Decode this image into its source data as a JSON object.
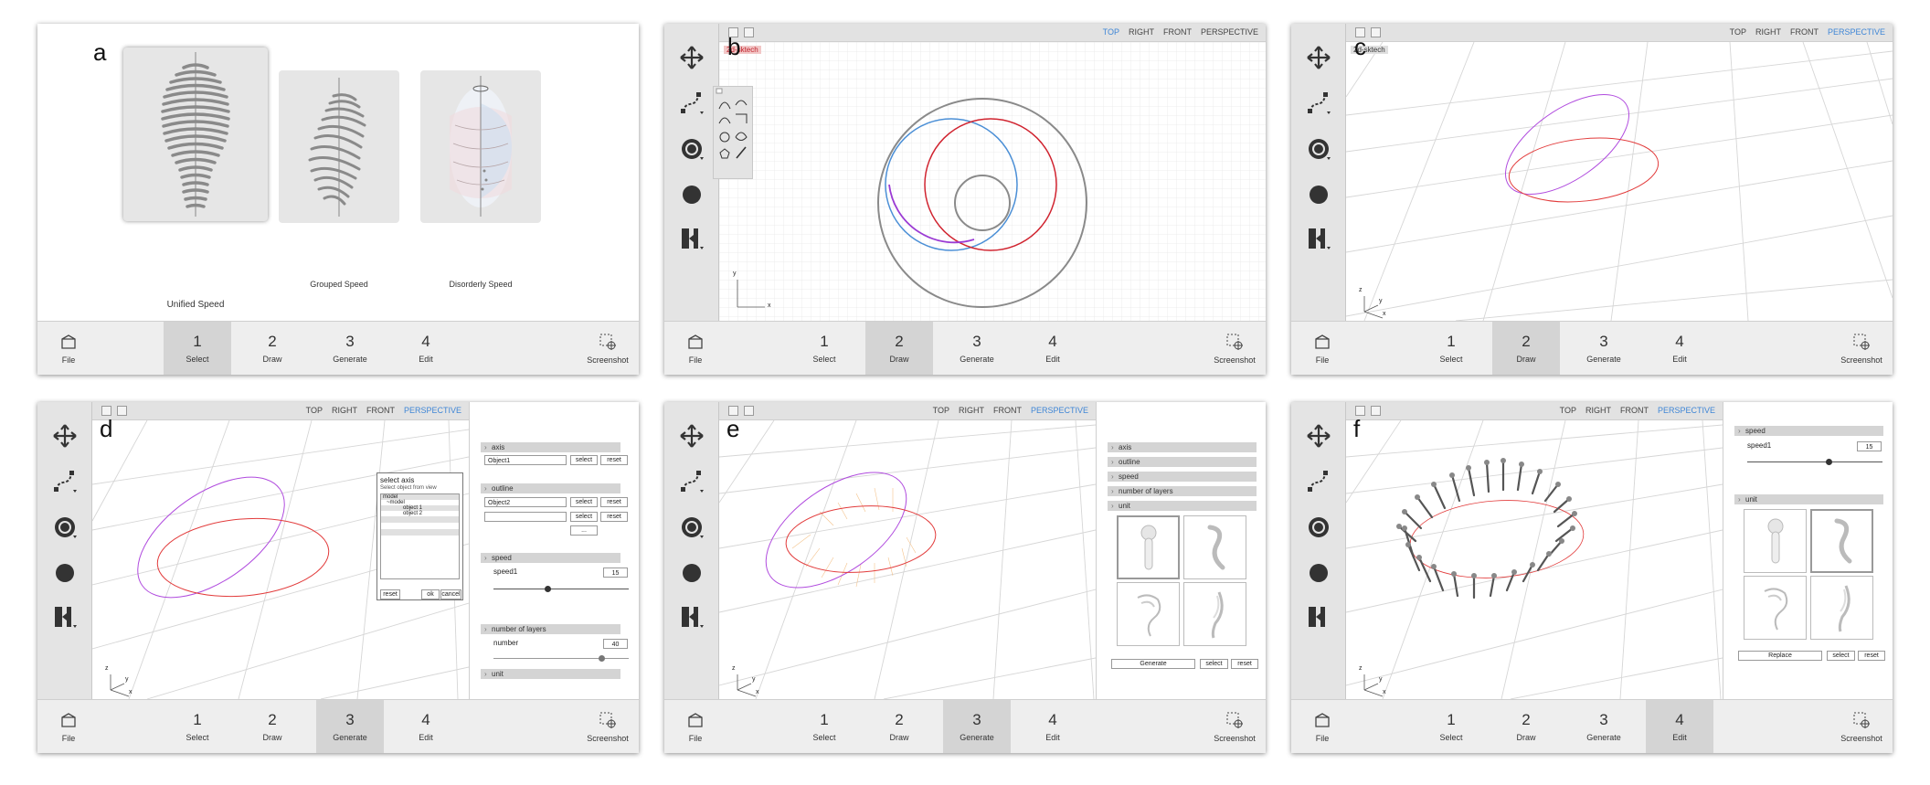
{
  "labels": {
    "a": "a",
    "b": "b",
    "c": "c",
    "d": "d",
    "e": "e",
    "f": "f"
  },
  "bottom": {
    "file": "File",
    "screenshot": "Screenshot",
    "tabs": [
      {
        "num": "1",
        "label": "Select"
      },
      {
        "num": "2",
        "label": "Draw"
      },
      {
        "num": "3",
        "label": "Generate"
      },
      {
        "num": "4",
        "label": "Edit"
      }
    ]
  },
  "views": {
    "top": "TOP",
    "right": "RIGHT",
    "front": "FRONT",
    "perspective": "PERSPECTIVE"
  },
  "panel_a": {
    "captions": [
      "Unified Speed",
      "Grouped Speed",
      "Disorderly Speed"
    ]
  },
  "panel_b": {
    "tag": "2d-sktech"
  },
  "panel_c": {
    "tag": "2d-sktech"
  },
  "axis_labels": {
    "x": "x",
    "y": "y",
    "z": "z"
  },
  "panel_d": {
    "axis": "axis",
    "outline": "outline",
    "speed": "speed",
    "layers": "number of layers",
    "unit": "unit",
    "object1": "Object1",
    "object2": "Object2",
    "select": "select",
    "reset": "reset",
    "more": "...",
    "speed_name": "speed1",
    "speed_value": "15",
    "number_name": "number",
    "number_value": "40",
    "speed_level": 0.4,
    "number_level": 0.8,
    "dialog": {
      "title": "select axis",
      "subtitle": "Select object from view",
      "items": [
        "model",
        "~model",
        "object 1",
        "object 2"
      ],
      "reset": "reset",
      "ok": "ok",
      "cancel": "cancel"
    }
  },
  "panel_e": {
    "sections": [
      "axis",
      "outline",
      "speed",
      "number of layers",
      "unit"
    ],
    "generate": "Generate",
    "select": "select",
    "reset": "reset"
  },
  "panel_f": {
    "speed": "speed",
    "speed_name": "speed1",
    "speed_value": "15",
    "speed_level": 0.6,
    "unit": "unit",
    "replace": "Replace",
    "select": "select",
    "reset": "reset"
  }
}
